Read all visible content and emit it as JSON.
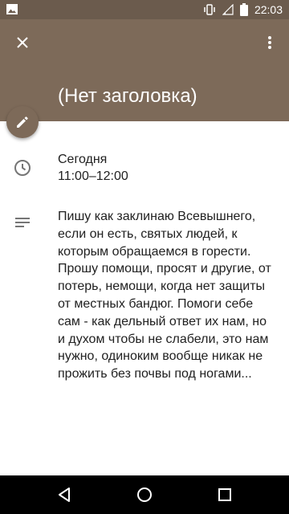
{
  "status_bar": {
    "time": "22:03",
    "icons": [
      "image-icon",
      "vibrate-icon",
      "signal-icon",
      "battery-icon"
    ]
  },
  "toolbar": {
    "close_icon": "close-icon",
    "more_icon": "more-vert-icon"
  },
  "event": {
    "title": "(Нет заголовка)",
    "date": "Сегодня",
    "time_range": "11:00–12:00",
    "description": "Пишу как заклинаю Всевышнего, если он есть, святых людей, к которым обращаемся в горести. Прошу помощи, просят и другие, от потерь, немощи, когда нет защиты от местных бандюг. Помоги себе сам - как дельный ответ их нам, но и духом чтобы не слабели, это нам нужно, одиноким вообще никак не прожить без почвы под ногами..."
  },
  "colors": {
    "header": "#7d6a59",
    "status_bar": "#6b5b4d",
    "text": "#212121",
    "icon_gray": "#757575"
  },
  "nav_bar": {
    "buttons": [
      "back-icon",
      "home-icon",
      "recents-icon"
    ]
  }
}
